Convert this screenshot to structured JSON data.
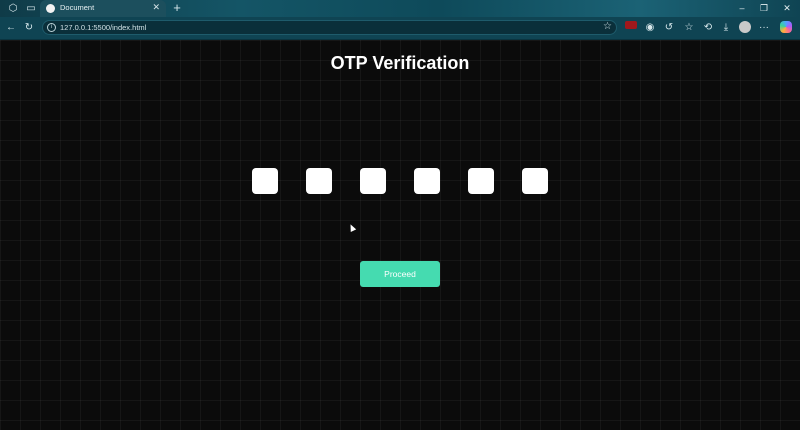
{
  "browser": {
    "tab": {
      "title": "Document",
      "close_icon": "close-icon"
    },
    "new_tab_label": "+",
    "address_bar": {
      "url": "127.0.0.1:5500/index.html"
    },
    "window_controls": {
      "minimize": "–",
      "restore": "❐",
      "close": "✕"
    },
    "toolbar_glyphs": {
      "back": "←",
      "refresh": "↻",
      "star": "☆",
      "favorites": "☆",
      "history": "⟲",
      "downloads": "⤓",
      "menu": "···"
    }
  },
  "page": {
    "title": "OTP Verification",
    "otp_fields": [
      {
        "value": ""
      },
      {
        "value": ""
      },
      {
        "value": ""
      },
      {
        "value": ""
      },
      {
        "value": ""
      },
      {
        "value": ""
      }
    ],
    "proceed_label": "Proceed"
  },
  "colors": {
    "background": "#0b0b0b",
    "button": "#45dbb0",
    "chrome": "#0f4453"
  }
}
